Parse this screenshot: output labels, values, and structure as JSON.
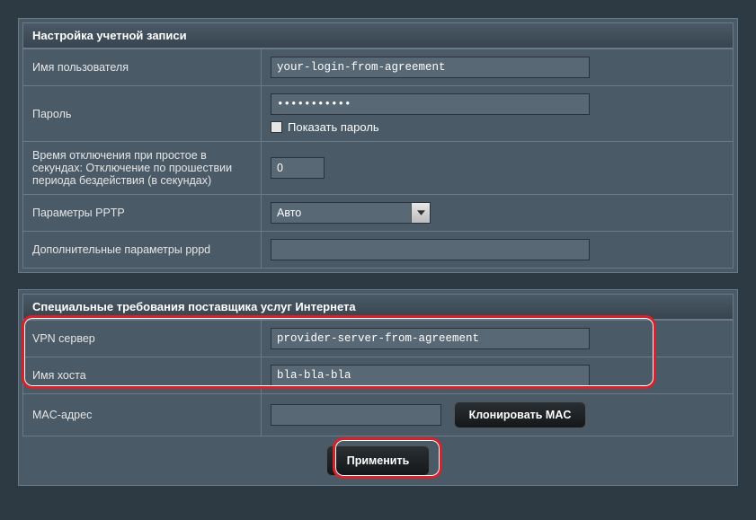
{
  "accountSection": {
    "title": "Настройка учетной записи",
    "usernameLabel": "Имя пользователя",
    "usernameValue": "your-login-from-agreement",
    "passwordLabel": "Пароль",
    "passwordValue": "•••••••••••",
    "showPasswordLabel": "Показать пароль",
    "idleLabel": "Время отключения при простое в секундах: Отключение по прошествии периода бездействия (в секундах)",
    "idleValue": "0",
    "pptpLabel": "Параметры PPTP",
    "pptpValue": "Авто",
    "pppdLabel": "Дополнительные параметры pppd",
    "pppdValue": ""
  },
  "ispSection": {
    "title": "Специальные требования поставщика услуг Интернета",
    "vpnLabel": "VPN сервер",
    "vpnValue": "provider-server-from-agreement",
    "hostLabel": "Имя хоста",
    "hostValue": "bla-bla-bla",
    "macLabel": "MAC-адрес",
    "macValue": "",
    "cloneMacLabel": "Клонировать MAC"
  },
  "applyLabel": "Применить"
}
